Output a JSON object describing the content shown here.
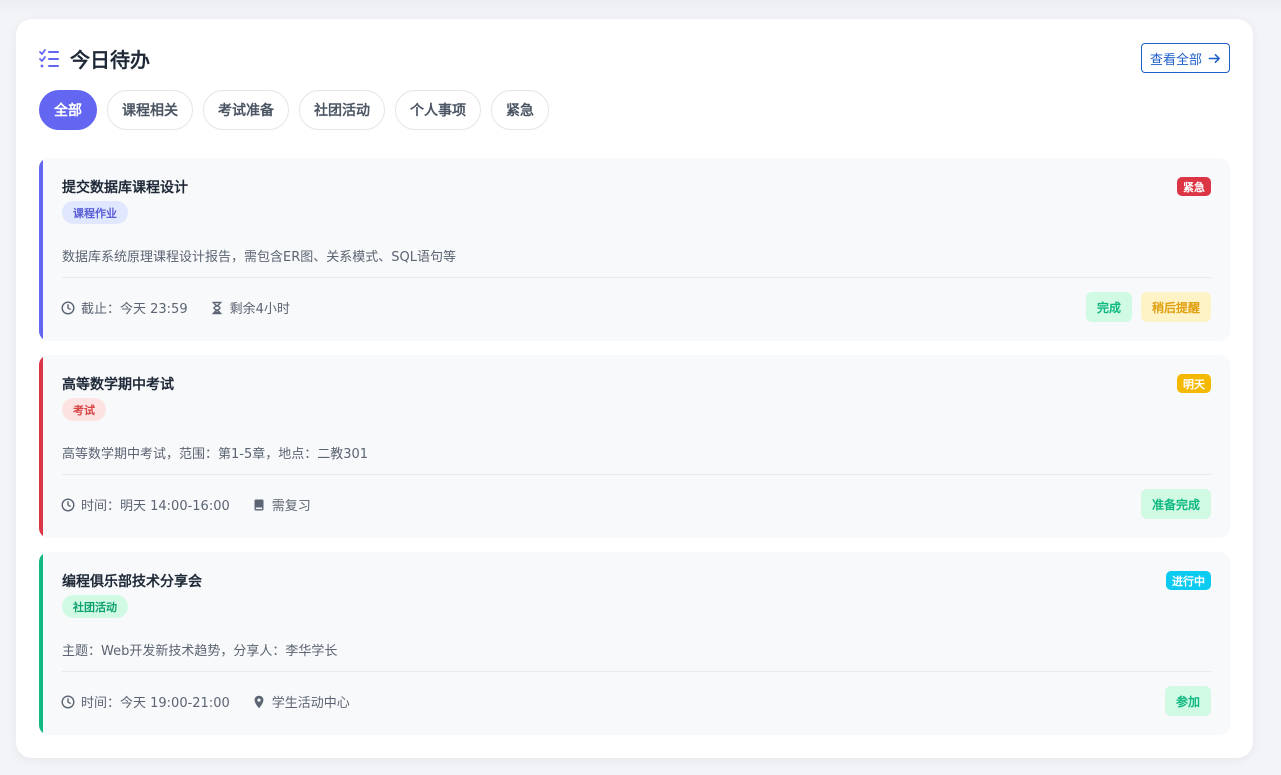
{
  "header": {
    "title": "今日待办",
    "view_all_label": "查看全部"
  },
  "tabs": [
    {
      "label": "全部",
      "active": true
    },
    {
      "label": "课程相关",
      "active": false
    },
    {
      "label": "考试准备",
      "active": false
    },
    {
      "label": "社团活动",
      "active": false
    },
    {
      "label": "个人事项",
      "active": false
    },
    {
      "label": "紧急",
      "active": false
    }
  ],
  "colors": {
    "primary": "#6366f1",
    "accent_blue": "#1d5fc9",
    "urgent_red": "#dc3545",
    "warning_yellow": "#f5b800",
    "info_cyan": "#0dcaf0",
    "success_green": "#10b981"
  },
  "tasks": [
    {
      "title": "提交数据库课程设计",
      "badge": "紧急",
      "tag": "课程作业",
      "description": "数据库系统原理课程设计报告，需包含ER图、关系模式、SQL语句等",
      "meta": [
        {
          "icon": "clock-icon",
          "text": "截止：今天 23:59"
        },
        {
          "icon": "hourglass-icon",
          "text": "剩余4小时"
        }
      ],
      "actions": [
        "完成",
        "稍后提醒"
      ]
    },
    {
      "title": "高等数学期中考试",
      "badge": "明天",
      "tag": "考试",
      "description": "高等数学期中考试，范围：第1-5章，地点：二教301",
      "meta": [
        {
          "icon": "clock-icon",
          "text": "时间：明天 14:00-16:00"
        },
        {
          "icon": "book-icon",
          "text": "需复习"
        }
      ],
      "actions": [
        "准备完成"
      ]
    },
    {
      "title": "编程俱乐部技术分享会",
      "badge": "进行中",
      "tag": "社团活动",
      "description": "主题：Web开发新技术趋势，分享人：李华学长",
      "meta": [
        {
          "icon": "clock-icon",
          "text": "时间：今天 19:00-21:00"
        },
        {
          "icon": "map-pin-icon",
          "text": "学生活动中心"
        }
      ],
      "actions": [
        "参加"
      ]
    }
  ]
}
